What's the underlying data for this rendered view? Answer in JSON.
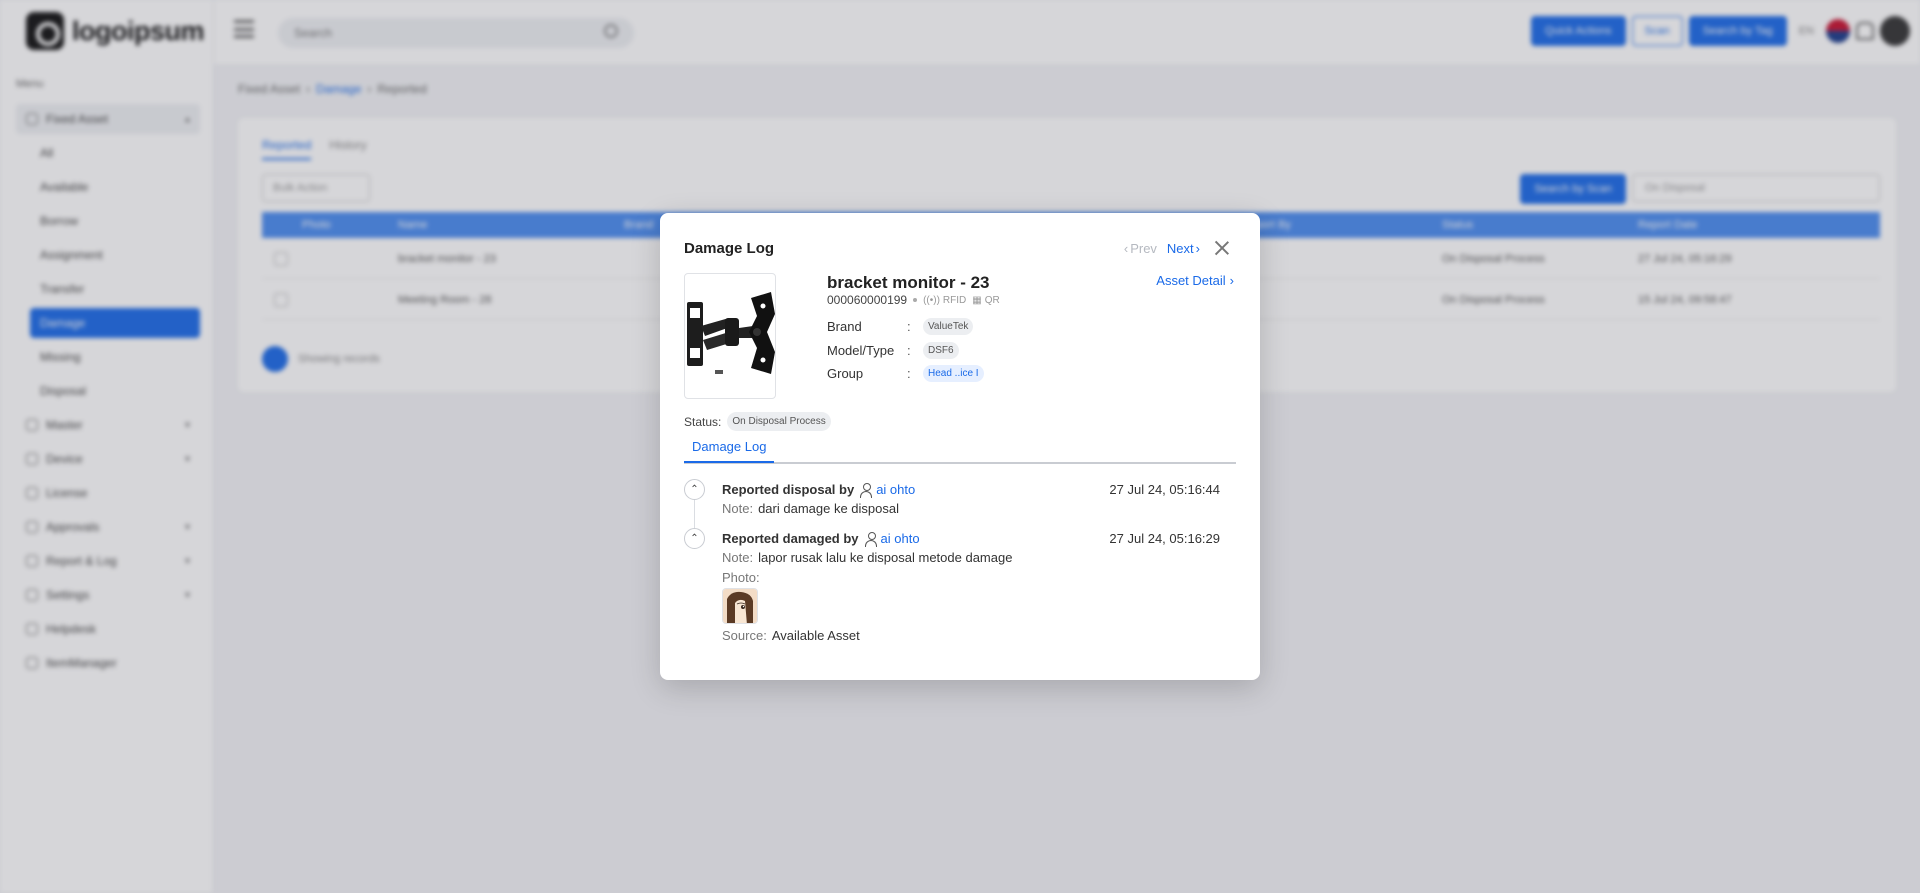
{
  "app": {
    "logo_text": "logoipsum",
    "menu_caption": "Menu",
    "search_placeholder": "Search",
    "top_buttons": {
      "quick_actions": "Quick Actions",
      "scan": "Scan",
      "search_by_tag": "Search by Tag"
    },
    "lang": "EN",
    "sidebar": [
      {
        "label": "Fixed Asset",
        "type": "parent"
      },
      {
        "label": "All",
        "type": "sub"
      },
      {
        "label": "Available",
        "type": "sub"
      },
      {
        "label": "Borrow",
        "type": "sub"
      },
      {
        "label": "Assignment",
        "type": "sub"
      },
      {
        "label": "Transfer",
        "type": "sub"
      },
      {
        "label": "Damage",
        "type": "active"
      },
      {
        "label": "Missing",
        "type": "sub"
      },
      {
        "label": "Disposal",
        "type": "sub"
      },
      {
        "label": "Master",
        "type": "group"
      },
      {
        "label": "Device",
        "type": "group"
      },
      {
        "label": "License",
        "type": "group"
      },
      {
        "label": "Approvals",
        "type": "group"
      },
      {
        "label": "Report & Log",
        "type": "group"
      },
      {
        "label": "Settings",
        "type": "group"
      },
      {
        "label": "Helpdesk",
        "type": "group"
      },
      {
        "label": "ItemManager",
        "type": "group"
      }
    ],
    "breadcrumb": [
      "Fixed Asset",
      "Damage",
      "Reported"
    ],
    "tabs": [
      "Reported",
      "History"
    ],
    "bulk_action": "Bulk Action",
    "search_by_scan": "Search by Scan",
    "status_filter": "On Disposal",
    "table_headers": [
      "Photo",
      "Name",
      "Brand",
      "Report By",
      "Status",
      "Report Date"
    ],
    "rows": [
      {
        "name": "bracket monitor - 23",
        "status": "On Disposal Process",
        "date": "27 Jul 24, 05:16:29"
      },
      {
        "name": "Meeting Room - 28",
        "status": "On Disposal Process",
        "date": "15 Jul 24, 09:58:47"
      }
    ],
    "showing": "Showing records"
  },
  "modal": {
    "title": "Damage Log",
    "prev_label": "Prev",
    "next_label": "Next",
    "asset": {
      "name": "bracket monitor - 23",
      "code": "000060000199",
      "rfid_label": "RFID",
      "qr_label": "QR",
      "detail_link": "Asset Detail",
      "attributes": [
        {
          "key": "Brand",
          "value": "ValueTek",
          "style": "grey"
        },
        {
          "key": "Model/Type",
          "value": "DSF6",
          "style": "grey"
        },
        {
          "key": "Group",
          "value": "Head ..ice I",
          "style": "blue"
        }
      ],
      "status_label": "Status:",
      "status_value": "On Disposal Process"
    },
    "tab_label": "Damage Log",
    "logs": [
      {
        "action": "Reported disposal by",
        "user": "ai ohto",
        "date": "27 Jul 24, 05:16:44",
        "note_label": "Note:",
        "note": "dari damage ke disposal"
      },
      {
        "action": "Reported damaged by",
        "user": "ai ohto",
        "date": "27 Jul 24, 05:16:29",
        "note_label": "Note:",
        "note": "lapor rusak lalu ke disposal metode damage",
        "photo_label": "Photo:",
        "source_label": "Source:",
        "source": "Available Asset"
      }
    ]
  }
}
